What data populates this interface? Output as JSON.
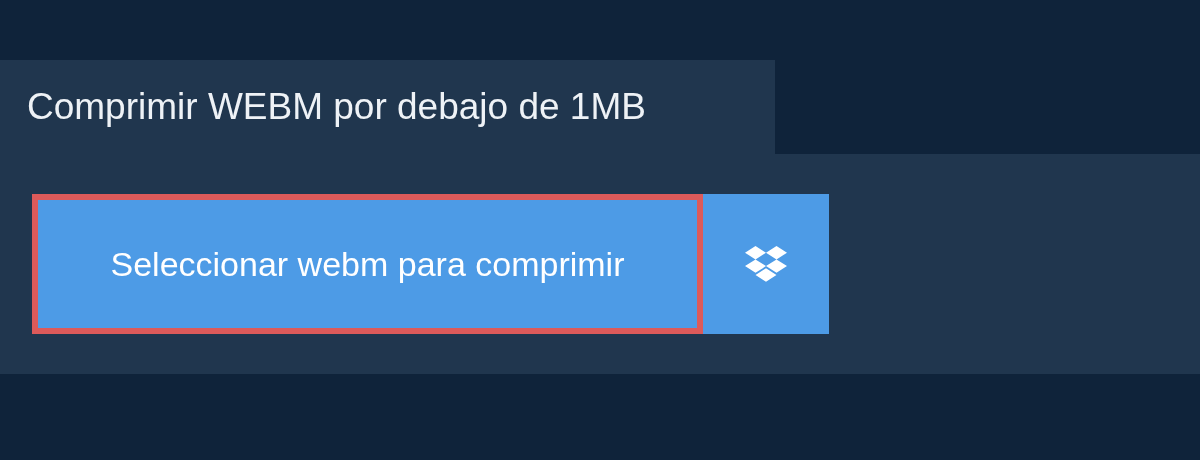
{
  "title": "Comprimir WEBM por debajo de 1MB",
  "upload_button": {
    "label": "Seleccionar webm para comprimir",
    "focused": true
  }
}
